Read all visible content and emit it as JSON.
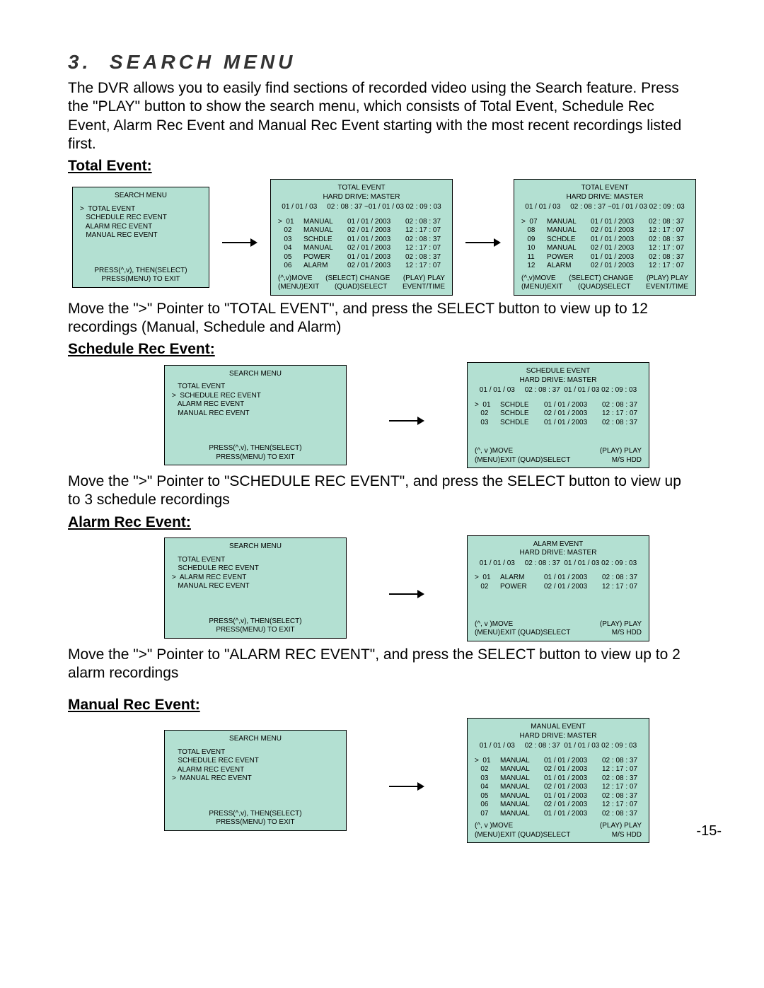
{
  "section_title": "3.  SEARCH MENU",
  "intro": "The DVR allows you to easily find sections of recorded video using the Search feature. Press the \"PLAY\" button to show the search menu, which consists of Total Event, Schedule Rec Event, Alarm Rec Event and Manual Rec Event starting with the most recent recordings listed first.",
  "page_num": "-15-",
  "search_menu_title": "SEARCH MENU",
  "menu_items": [
    "TOTAL EVENT",
    "SCHEDULE REC EVENT",
    "ALARM REC EVENT",
    "MANUAL REC EVENT"
  ],
  "menu_hint1": "PRESS(^,v), THEN(SELECT)",
  "menu_hint2": "PRESS(MENU) TO EXIT",
  "hard_drive": "HARD DRIVE:  MASTER",
  "footer3_a": {
    "l": "(^,v)MOVE",
    "m": "(SELECT) CHANGE",
    "r": "(PLAY) PLAY"
  },
  "footer3_b": {
    "l": "(MENU)EXIT",
    "m": "(QUAD)SELECT",
    "r": "EVENT/TIME"
  },
  "footer2_a": {
    "l": "(^, v )MOVE",
    "r": "(PLAY) PLAY"
  },
  "footer2_b": {
    "l": "(MENU)EXIT   (QUAD)SELECT",
    "r": "M/S HDD"
  },
  "total": {
    "hdr": "Total Event:",
    "text": "Move the \">\" Pointer to \"TOTAL EVENT\", and press the SELECT button to view up to 12 recordings (Manual, Schedule and Alarm)",
    "selected": 0,
    "list1": {
      "title": "TOTAL EVENT",
      "range": "01 / 01 / 03     02 : 08 : 37 ~01 / 01 / 03 02 : 09 : 03",
      "rows": [
        {
          "i": "01",
          "t": "MANUAL",
          "d": "01 / 01 / 2003",
          "tm": "02 : 08 : 37"
        },
        {
          "i": "02",
          "t": "MANUAL",
          "d": "02 / 01 / 2003",
          "tm": "12 : 17 : 07"
        },
        {
          "i": "03",
          "t": "SCHDLE",
          "d": "01 / 01 / 2003",
          "tm": "02 : 08 : 37"
        },
        {
          "i": "04",
          "t": "MANUAL",
          "d": "02 / 01 / 2003",
          "tm": "12 : 17 : 07"
        },
        {
          "i": "05",
          "t": "POWER",
          "d": "01 / 01 / 2003",
          "tm": "02 : 08 : 37"
        },
        {
          "i": "06",
          "t": "ALARM",
          "d": "02 / 01 / 2003",
          "tm": "12 : 17 : 07"
        }
      ]
    },
    "list2": {
      "title": "TOTAL EVENT",
      "range": "01 / 01 / 03     02 : 08 : 37 ~01 / 01 / 03 02 : 09 : 03",
      "rows": [
        {
          "i": "07",
          "t": "MANUAL",
          "d": "01 / 01 / 2003",
          "tm": "02 : 08 : 37"
        },
        {
          "i": "08",
          "t": "MANUAL",
          "d": "02 / 01 / 2003",
          "tm": "12 : 17 : 07"
        },
        {
          "i": "09",
          "t": "SCHDLE",
          "d": "01 / 01 / 2003",
          "tm": "02 : 08 : 37"
        },
        {
          "i": "10",
          "t": "MANUAL",
          "d": "02 / 01 / 2003",
          "tm": "12 : 17 : 07"
        },
        {
          "i": "11",
          "t": "POWER",
          "d": "01 / 01 / 2003",
          "tm": "02 : 08 : 37"
        },
        {
          "i": "12",
          "t": "ALARM",
          "d": "02 / 01 / 2003",
          "tm": "12 : 17 : 07"
        }
      ]
    }
  },
  "schedule": {
    "hdr": "Schedule Rec Event:",
    "text": "Move the \">\" Pointer to \"SCHEDULE REC EVENT\", and press the SELECT button to view up to 3 schedule recordings",
    "selected": 1,
    "list": {
      "title": "SCHEDULE EVENT",
      "range": "01 / 01 / 03     02 : 08 : 37  01 / 01 / 03 02 : 09 : 03",
      "rows": [
        {
          "i": "01",
          "t": "SCHDLE",
          "d": "01 / 01 / 2003",
          "tm": "02 : 08 : 37"
        },
        {
          "i": "02",
          "t": "SCHDLE",
          "d": "02 / 01 / 2003",
          "tm": "12 : 17 : 07"
        },
        {
          "i": "03",
          "t": "SCHDLE",
          "d": "01 / 01 / 2003",
          "tm": "02 : 08 : 37"
        }
      ]
    }
  },
  "alarm": {
    "hdr": "Alarm Rec Event:",
    "text": "Move the \">\" Pointer to \"ALARM REC EVENT\", and press the SELECT button to view up to 2 alarm recordings",
    "selected": 2,
    "list": {
      "title": "ALARM EVENT",
      "range": "01 / 01 / 03     02 : 08 : 37  01 / 01 / 03 02 : 09 : 03",
      "rows": [
        {
          "i": "01",
          "t": "ALARM",
          "d": "01 / 01 / 2003",
          "tm": "02 : 08 : 37"
        },
        {
          "i": "02",
          "t": "POWER",
          "d": "02 / 01 / 2003",
          "tm": "12 : 17 : 07"
        }
      ]
    }
  },
  "manual": {
    "hdr": "Manual Rec Event:",
    "selected": 3,
    "list": {
      "title": "MANUAL EVENT",
      "range": "01 / 01 / 03     02 : 08 : 37  01 / 01 / 03 02 : 09 : 03",
      "rows": [
        {
          "i": "01",
          "t": "MANUAL",
          "d": "01 / 01 / 2003",
          "tm": "02 : 08 : 37"
        },
        {
          "i": "02",
          "t": "MANUAL",
          "d": "02 / 01 / 2003",
          "tm": "12 : 17 : 07"
        },
        {
          "i": "03",
          "t": "MANUAL",
          "d": "01 / 01 / 2003",
          "tm": "02 : 08 : 37"
        },
        {
          "i": "04",
          "t": "MANUAL",
          "d": "02 / 01 / 2003",
          "tm": "12 : 17 : 07"
        },
        {
          "i": "05",
          "t": "MANUAL",
          "d": "01 / 01 / 2003",
          "tm": "02 : 08 : 37"
        },
        {
          "i": "06",
          "t": "MANUAL",
          "d": "02 / 01 / 2003",
          "tm": "12 : 17 : 07"
        },
        {
          "i": "07",
          "t": "MANUAL",
          "d": "01 / 01 / 2003",
          "tm": "02 : 08 : 37"
        }
      ]
    }
  }
}
